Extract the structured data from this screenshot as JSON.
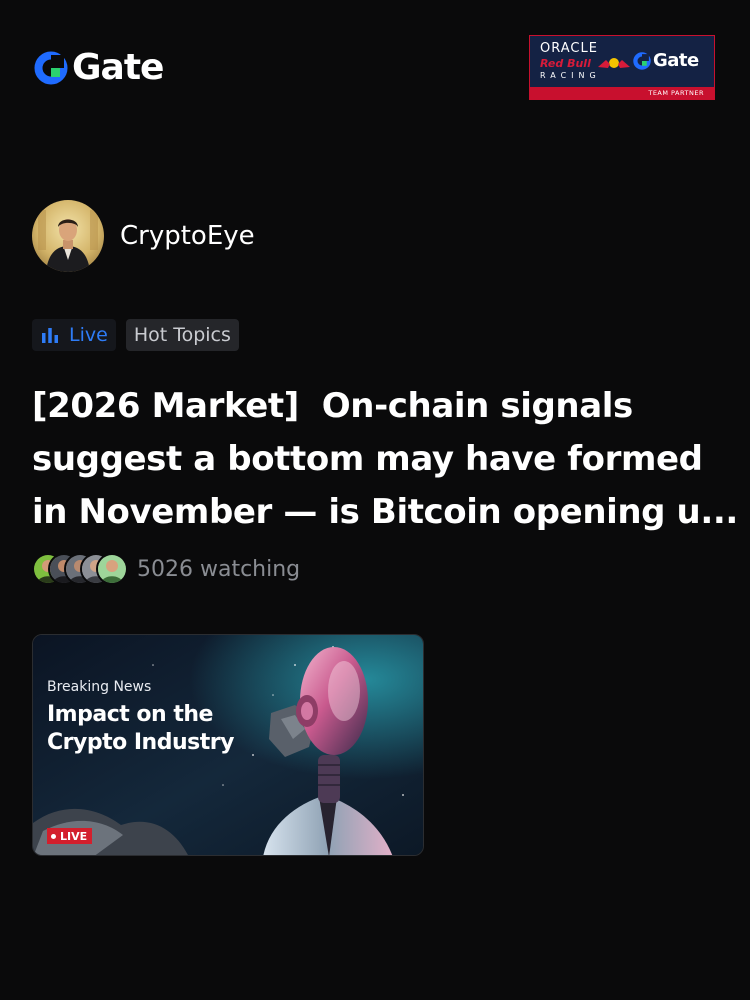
{
  "brand": {
    "name": "Gate",
    "accent": "#1f6bff",
    "accent_tail": "#2bd16e"
  },
  "partner": {
    "line1": "ORACLE",
    "line2": "Red Bull",
    "line3": "RACING",
    "gate": "Gate",
    "badge": "TEAM PARTNER"
  },
  "author": {
    "name": "CryptoEye"
  },
  "tags": {
    "live": "Live",
    "topic": "Hot Topics"
  },
  "post": {
    "title": "[2026 Market]  On-chain signals\nsuggest a bottom may have formed\nin November — is Bitcoin opening u...",
    "watch_count": "5026 watching"
  },
  "video": {
    "kicker": "Breaking News",
    "headline": "Impact on the Crypto Industry",
    "live_badge": "LIVE"
  },
  "icons": [
    "gate-logo-icon",
    "bar-chart-icon",
    "live-dot-icon"
  ]
}
